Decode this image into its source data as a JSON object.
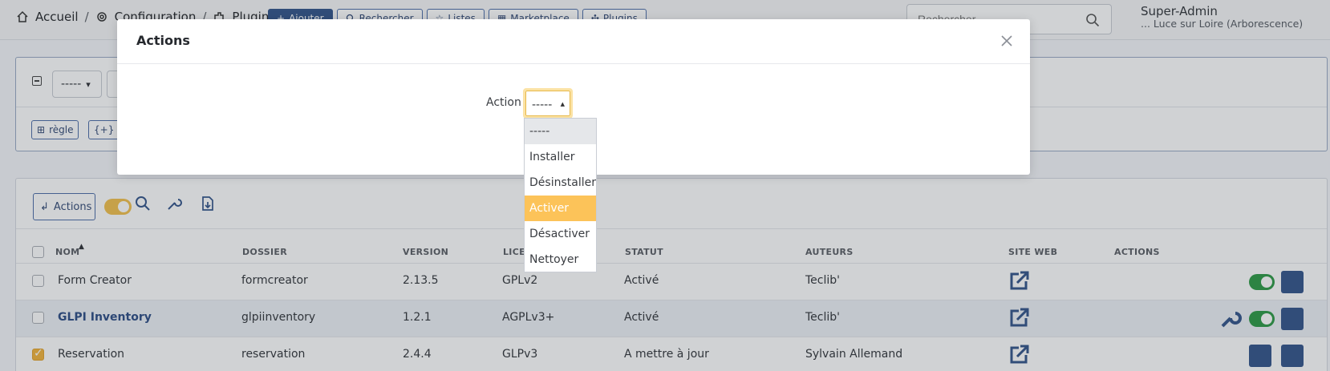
{
  "breadcrumb": {
    "home": "Accueil",
    "config": "Configuration",
    "plugins": "Plugins"
  },
  "toolbar": {
    "add": "Ajouter",
    "search": "Rechercher",
    "lists": "Listes",
    "marketplace": "Marketplace",
    "plugins": "Plugins"
  },
  "search": {
    "placeholder": "Rechercher"
  },
  "user": {
    "name": "Super-Admin",
    "entity": "... Luce sur Loire (Arborescence)"
  },
  "criteria": {
    "field_value": "-----",
    "rule_button": "règle",
    "group_button": "g"
  },
  "list": {
    "actions_button": "Actions",
    "columns": [
      "NOM",
      "DOSSIER",
      "VERSION",
      "LICEN",
      "STATUT",
      "AUTEURS",
      "SITE WEB",
      "ACTIONS"
    ],
    "rows": [
      {
        "name": "Form Creator",
        "folder": "formcreator",
        "version": "2.13.5",
        "license": "GPLv2",
        "status": "Activé",
        "authors": "Teclib'",
        "checked": false,
        "name_link": false
      },
      {
        "name": "GLPI Inventory",
        "folder": "glpiinventory",
        "version": "1.2.1",
        "license": "AGPLv3+",
        "status": "Activé",
        "authors": "Teclib'",
        "checked": false,
        "name_link": true
      },
      {
        "name": "Reservation",
        "folder": "reservation",
        "version": "2.4.4",
        "license": "GLPv3",
        "status": "A mettre à jour",
        "authors": "Sylvain Allemand",
        "checked": true,
        "name_link": false
      }
    ]
  },
  "modal": {
    "title": "Actions",
    "action_label": "Action",
    "select_value": "-----",
    "options": [
      "-----",
      "Installer",
      "Désinstaller",
      "Activer",
      "Désactiver",
      "Nettoyer"
    ],
    "highlighted_option": "Activer"
  },
  "colors": {
    "accent": "#fcc359",
    "primary": "#34558b",
    "success": "#2e9a46"
  }
}
